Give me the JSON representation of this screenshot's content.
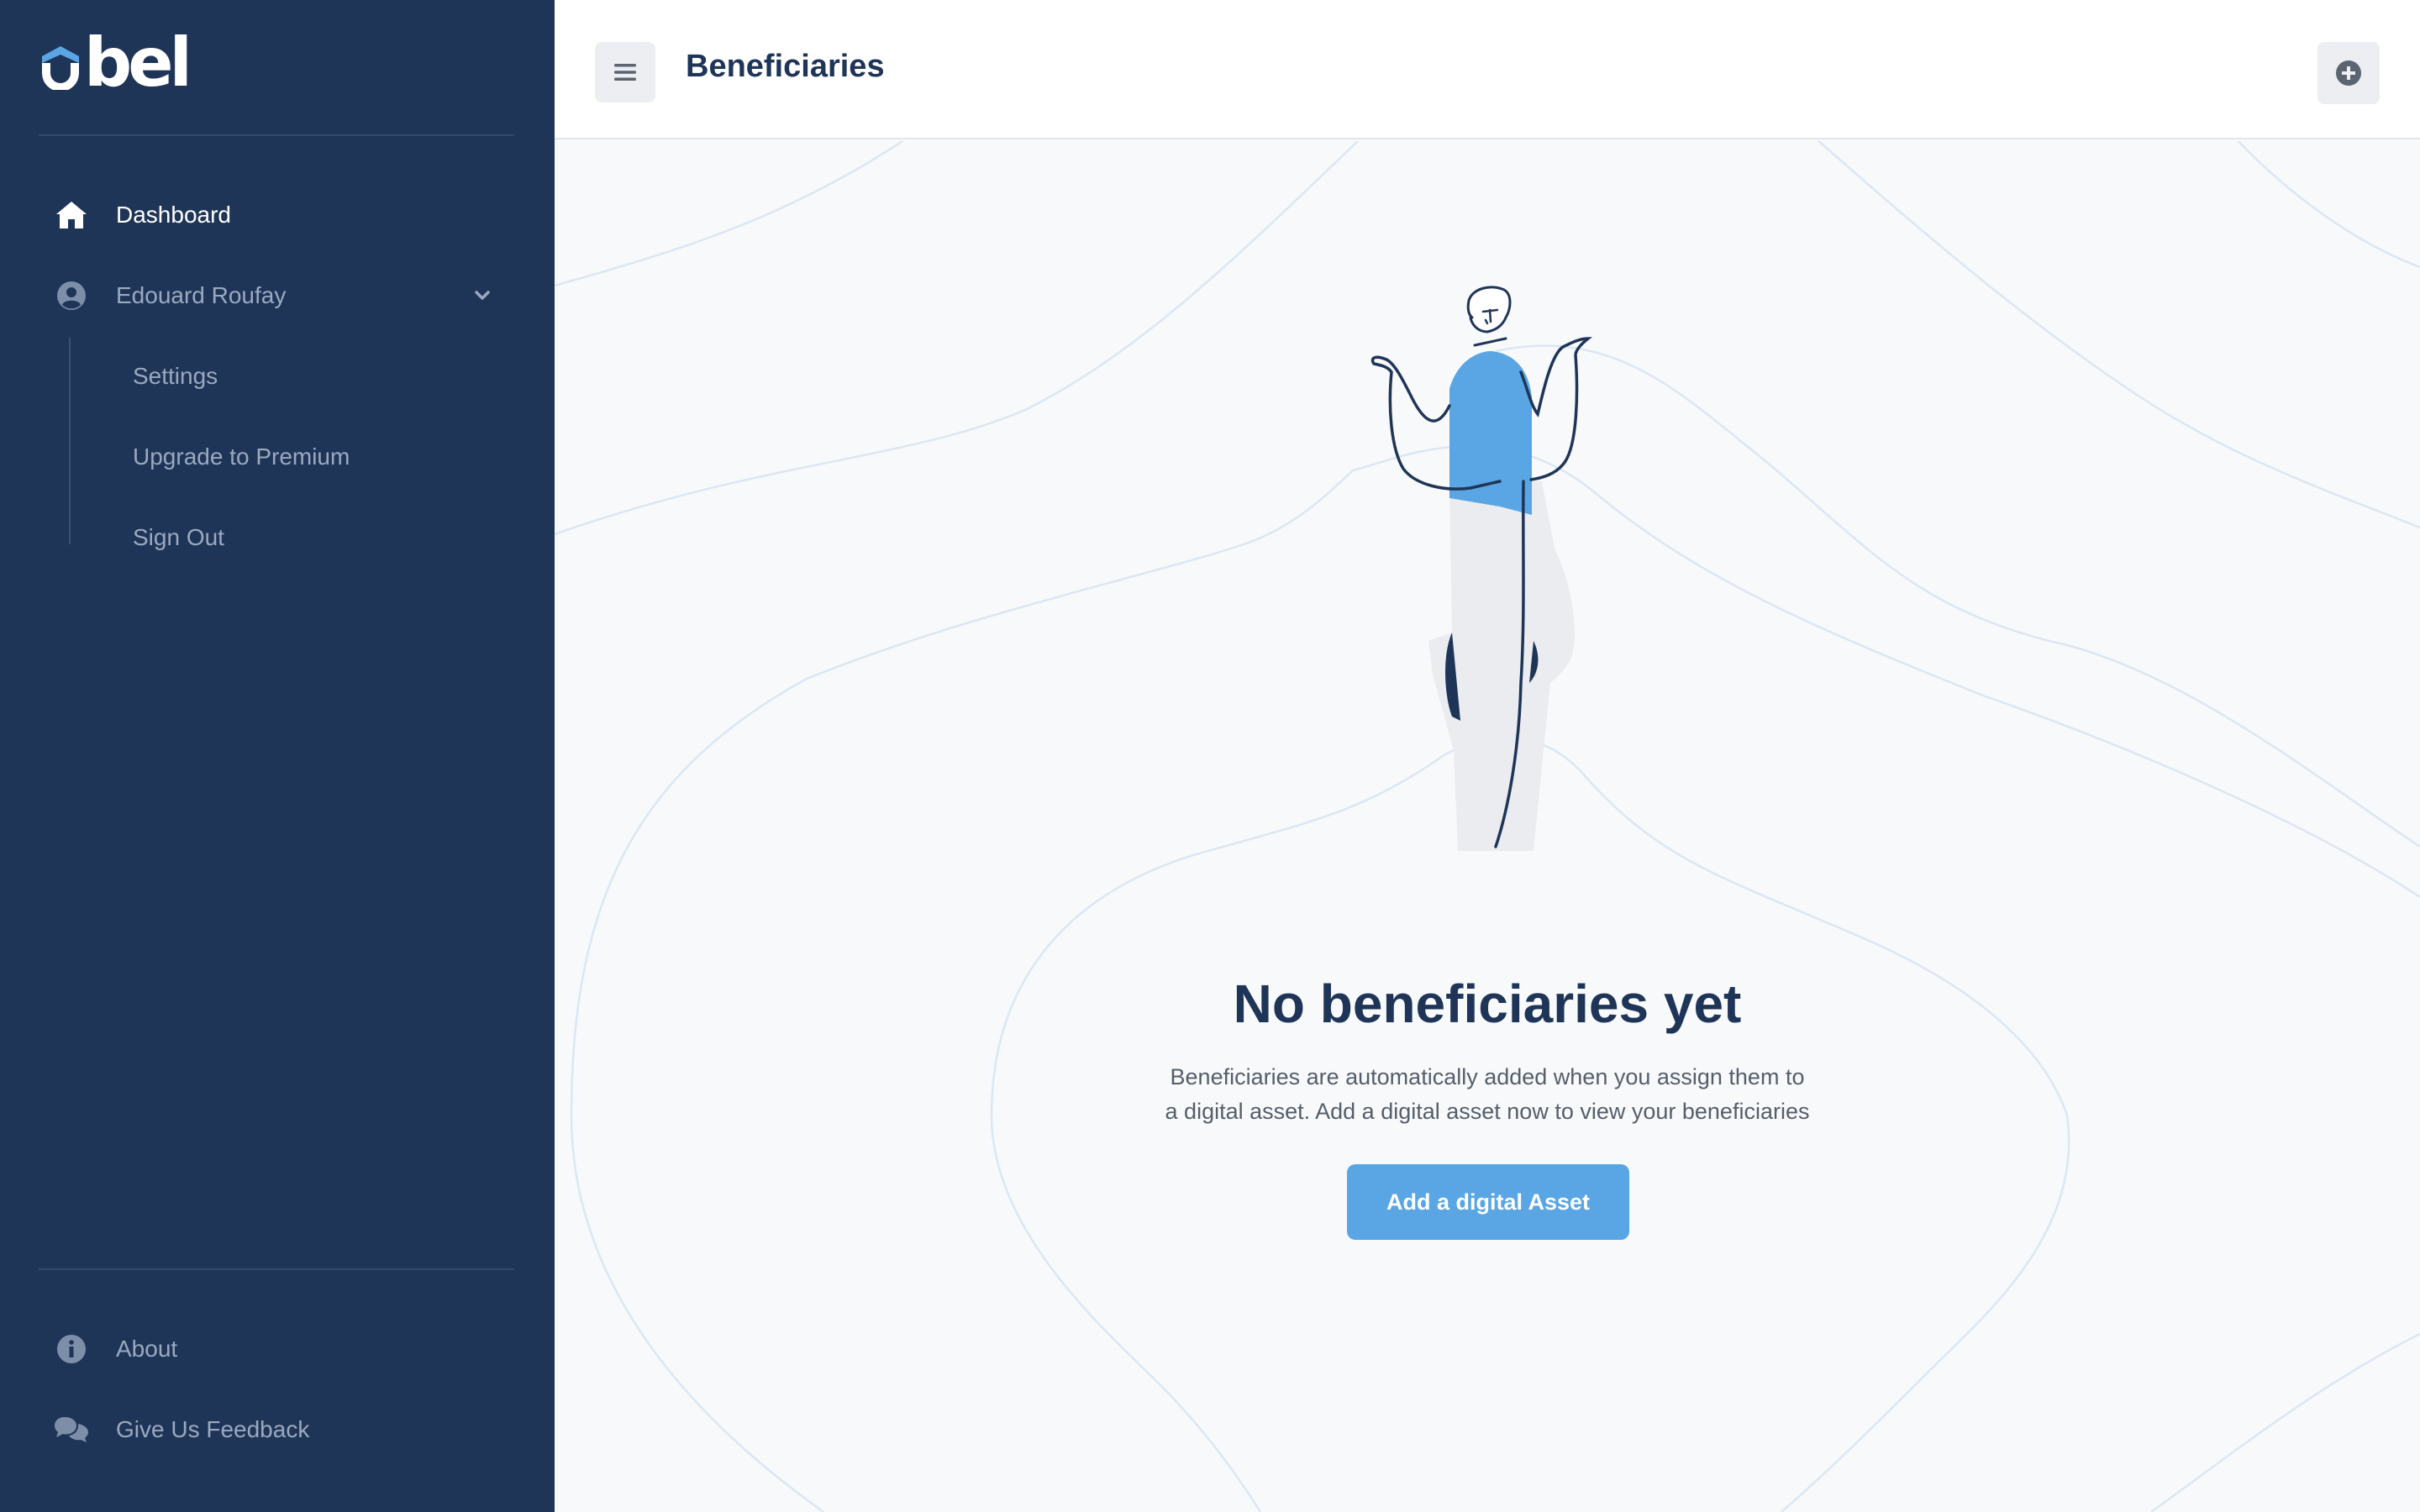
{
  "app": {
    "logo_text": "bel",
    "brand_color": "#1f3558",
    "accent_color": "#5aa6e4"
  },
  "sidebar": {
    "items": [
      {
        "label": "Dashboard",
        "icon": "home-icon",
        "active": true
      },
      {
        "label": "Edouard Roufay",
        "icon": "user-circle-icon",
        "expanded": true
      }
    ],
    "submenu": [
      {
        "label": "Settings"
      },
      {
        "label": "Upgrade to Premium"
      },
      {
        "label": "Sign Out"
      }
    ],
    "footer": [
      {
        "label": "About",
        "icon": "info-icon"
      },
      {
        "label": "Give Us Feedback",
        "icon": "comments-icon"
      }
    ]
  },
  "header": {
    "title": "Beneficiaries",
    "menu_icon": "hamburger-icon",
    "action_icon": "plus-circle-icon"
  },
  "empty_state": {
    "title": "No beneficiaries yet",
    "description_line1": "Beneficiaries are automatically added when you assign them to",
    "description_line2": "a digital asset. Add a digital asset now to view your beneficiaries",
    "button_label": "Add a digital Asset"
  }
}
